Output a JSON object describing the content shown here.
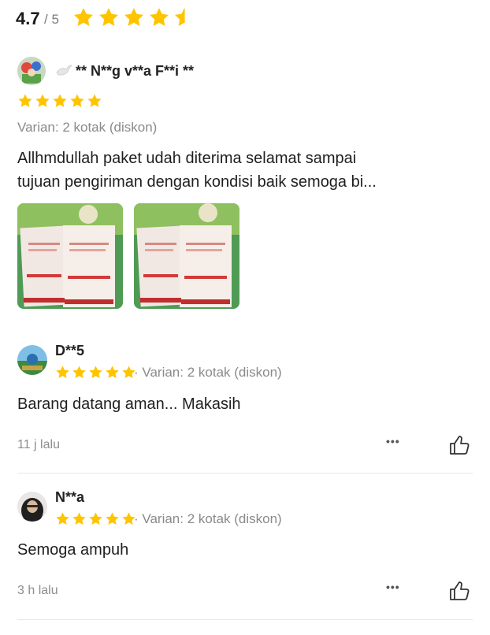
{
  "summary": {
    "rating": "4.7",
    "max": "/ 5",
    "stars_value": 4.5,
    "star_color": "#ffc400"
  },
  "reviews": [
    {
      "username": "** N**g v**a F**i **",
      "stars": 5,
      "variant": "Varian: 2 kotak (diskon)",
      "text_line1": "Allhmdullah paket udah diterima selamat sampai",
      "text_line2": "tujuan pengiriman dengan kondisi baik semoga bi...",
      "photos": [
        "review-photo-1",
        "review-photo-2"
      ]
    },
    {
      "username": "D**5",
      "stars": 5,
      "variant": "· Varian: 2 kotak (diskon)",
      "text": "Barang datang aman... Makasih",
      "time": "11 j lalu",
      "more": "•••"
    },
    {
      "username": "N**a",
      "stars": 5,
      "variant": "· Varian: 2 kotak (diskon)",
      "text": "Semoga ampuh",
      "time": "3 h lalu",
      "more": "•••"
    }
  ]
}
